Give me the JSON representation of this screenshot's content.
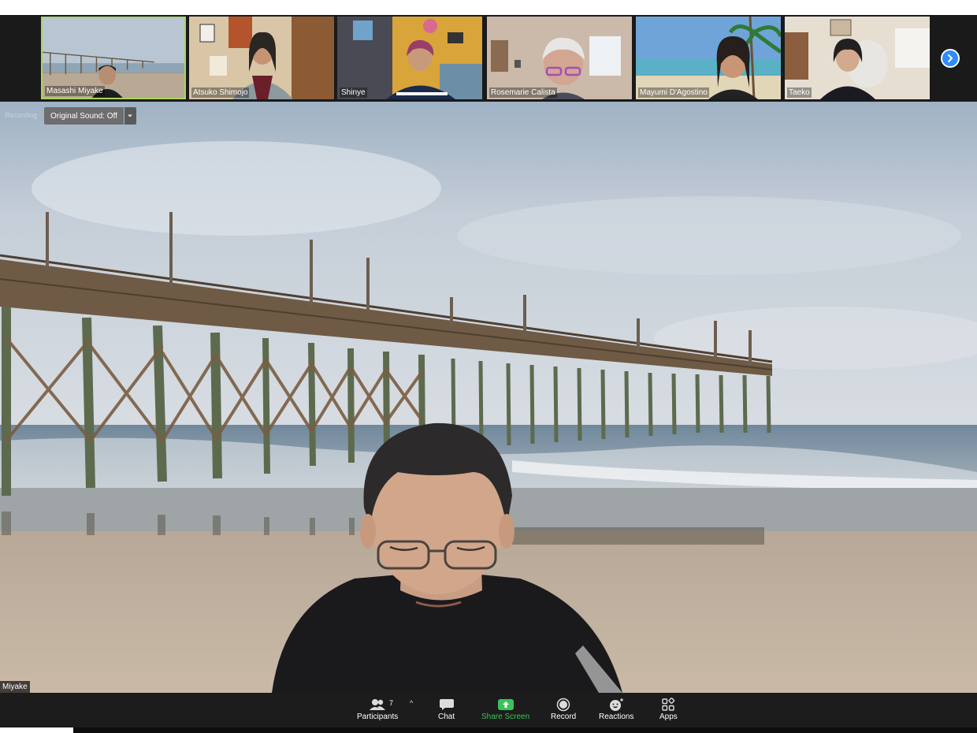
{
  "participants_strip": [
    {
      "name": "Masashi Miyake",
      "active": true
    },
    {
      "name": "Atsuko Shimojo",
      "active": false
    },
    {
      "name": "Shinye",
      "active": false
    },
    {
      "name": "Rosemarie Calista",
      "active": false
    },
    {
      "name": "Mayumi D'Agostino",
      "active": false
    },
    {
      "name": "Taeko",
      "active": false
    }
  ],
  "strip_next_icon": "chevron-right-icon",
  "main_view": {
    "recording_label": "Recording",
    "original_sound_label": "Original Sound: Off",
    "speaker_name": "Miyake"
  },
  "toolbar": {
    "participants_count": "7",
    "participants_label": "Participants",
    "chat_label": "Chat",
    "share_label": "Share Screen",
    "record_label": "Record",
    "reactions_label": "Reactions",
    "apps_label": "Apps"
  },
  "colors": {
    "share_green": "#3ac35a",
    "active_border": "#a8d65a",
    "next_button": "#2d8cff"
  }
}
